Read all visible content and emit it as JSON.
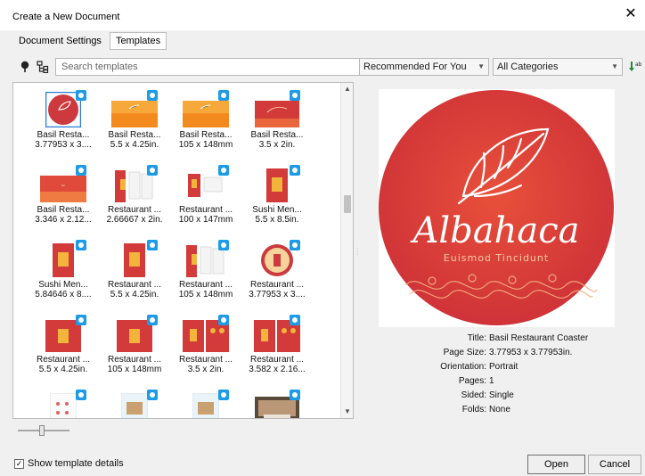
{
  "window": {
    "title": "Create a New Document",
    "close_glyph": "✕"
  },
  "tabs": [
    {
      "label": "Document Settings",
      "active": false
    },
    {
      "label": "Templates",
      "active": true
    }
  ],
  "toolbar": {
    "search_placeholder": "Search templates",
    "filter_dropdown": "Recommended For You",
    "category_dropdown": "All Categories",
    "icons": [
      "pin-icon",
      "hierarchy-icon",
      "sort-icon"
    ]
  },
  "templates": [
    {
      "name": "Basil Resta...",
      "size": "3.77953 x 3....",
      "kind": "circle",
      "selected": true
    },
    {
      "name": "Basil Resta...",
      "size": "5.5 x 4.25in.",
      "kind": "orange-card"
    },
    {
      "name": "Basil Resta...",
      "size": "105 x 148mm",
      "kind": "orange-card"
    },
    {
      "name": "Basil Resta...",
      "size": "3.5 x 2in.",
      "kind": "red-card"
    },
    {
      "name": "Basil Resta...",
      "size": "3.346 x 2.12...",
      "kind": "red-card-wide"
    },
    {
      "name": "Restaurant ...",
      "size": "2.66667 x 2in.",
      "kind": "menu-fold"
    },
    {
      "name": "Restaurant ...",
      "size": "100 x 147mm",
      "kind": "menu-small"
    },
    {
      "name": "Sushi Men...",
      "size": "5.5 x 8.5in.",
      "kind": "menu-tall"
    },
    {
      "name": "Sushi Men...",
      "size": "5.84646 x 8....",
      "kind": "menu-tall"
    },
    {
      "name": "Restaurant ...",
      "size": "5.5 x 4.25in.",
      "kind": "menu-tall"
    },
    {
      "name": "Restaurant ...",
      "size": "105 x 148mm",
      "kind": "menu-fold"
    },
    {
      "name": "Restaurant ...",
      "size": "3.77953 x 3....",
      "kind": "gold-circle"
    },
    {
      "name": "Restaurant ...",
      "size": "5.5 x 4.25in.",
      "kind": "red-square"
    },
    {
      "name": "Restaurant ...",
      "size": "105 x 148mm",
      "kind": "red-square"
    },
    {
      "name": "Restaurant ...",
      "size": "3.5 x 2in.",
      "kind": "red-split"
    },
    {
      "name": "Restaurant ...",
      "size": "3.582 x 2.16...",
      "kind": "red-split"
    },
    {
      "name": "",
      "size": "",
      "kind": "white-sheet"
    },
    {
      "name": "",
      "size": "",
      "kind": "blue-sheet"
    },
    {
      "name": "",
      "size": "",
      "kind": "blue-sheet"
    },
    {
      "name": "",
      "size": "",
      "kind": "photo"
    }
  ],
  "preview": {
    "brand": "Albahaca",
    "tagline": "Euismod Tincidunt",
    "colors": {
      "outer": "#cf3338",
      "inner": "#e8503a",
      "accent": "#f3b184"
    }
  },
  "details": [
    {
      "label": "Title:",
      "value": "Basil Restaurant Coaster"
    },
    {
      "label": "Page Size:",
      "value": "3.77953 x 3.77953in."
    },
    {
      "label": "Orientation:",
      "value": "Portrait"
    },
    {
      "label": "Pages:",
      "value": "1"
    },
    {
      "label": "Sided:",
      "value": "Single"
    },
    {
      "label": "Folds:",
      "value": "None"
    }
  ],
  "footer": {
    "show_details_label": "Show template details",
    "show_details_checked": true,
    "check_glyph": "✓",
    "open_label": "Open",
    "cancel_label": "Cancel"
  }
}
